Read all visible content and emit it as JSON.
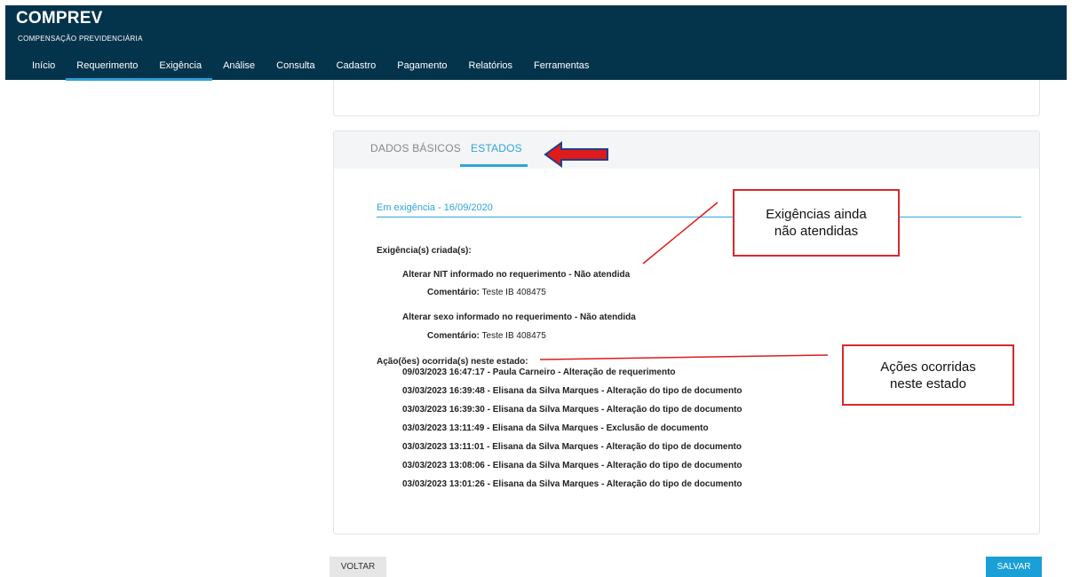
{
  "app": {
    "title": "COMPREV",
    "subtitle": "COMPENSAÇÃO PREVIDENCIÁRIA"
  },
  "nav": [
    {
      "label": "Início"
    },
    {
      "label": "Requerimento",
      "active": true
    },
    {
      "label": "Exigência",
      "active": true
    },
    {
      "label": "Análise"
    },
    {
      "label": "Consulta"
    },
    {
      "label": "Cadastro"
    },
    {
      "label": "Pagamento"
    },
    {
      "label": "Relatórios"
    },
    {
      "label": "Ferramentas"
    }
  ],
  "tabs": {
    "basic": "DADOS BÁSICOS",
    "states": "ESTADOS"
  },
  "state": {
    "header": "Em exigência - 16/09/2020",
    "created_label": "Exigência(s) criada(s):",
    "requirements": [
      {
        "title": "Alterar NIT informado no requerimento - Não atendida",
        "comment_label": "Comentário:",
        "comment": " Teste IB 408475"
      },
      {
        "title": "Alterar sexo informado no requerimento - Não atendida",
        "comment_label": "Comentário:",
        "comment": " Teste IB 408475"
      }
    ],
    "actions_label": "Ação(ões) ocorrida(s) neste estado:",
    "actions": [
      "09/03/2023 16:47:17 - Paula Carneiro - Alteração de requerimento",
      "03/03/2023 16:39:48 - Elisana da Silva Marques - Alteração do tipo de documento",
      "03/03/2023 16:39:30 - Elisana da Silva Marques - Alteração do tipo de documento",
      "03/03/2023 13:11:49 - Elisana da Silva Marques - Exclusão de documento",
      "03/03/2023 13:11:01 - Elisana da Silva Marques - Alteração do tipo de documento",
      "03/03/2023 13:08:06 - Elisana da Silva Marques - Alteração do tipo de documento",
      "03/03/2023 13:01:26 - Elisana da Silva Marques - Alteração do tipo de documento"
    ]
  },
  "buttons": {
    "back": "VOLTAR",
    "save": "SALVAR"
  },
  "annotations": {
    "pending_line1": "Exigências ainda",
    "pending_line2": "não atendidas",
    "actions_line1": "Ações ocorridas",
    "actions_line2": "neste estado"
  },
  "colors": {
    "header_bg": "#04344c",
    "accent": "#2ea4d8",
    "annotation": "#d62a2a"
  }
}
